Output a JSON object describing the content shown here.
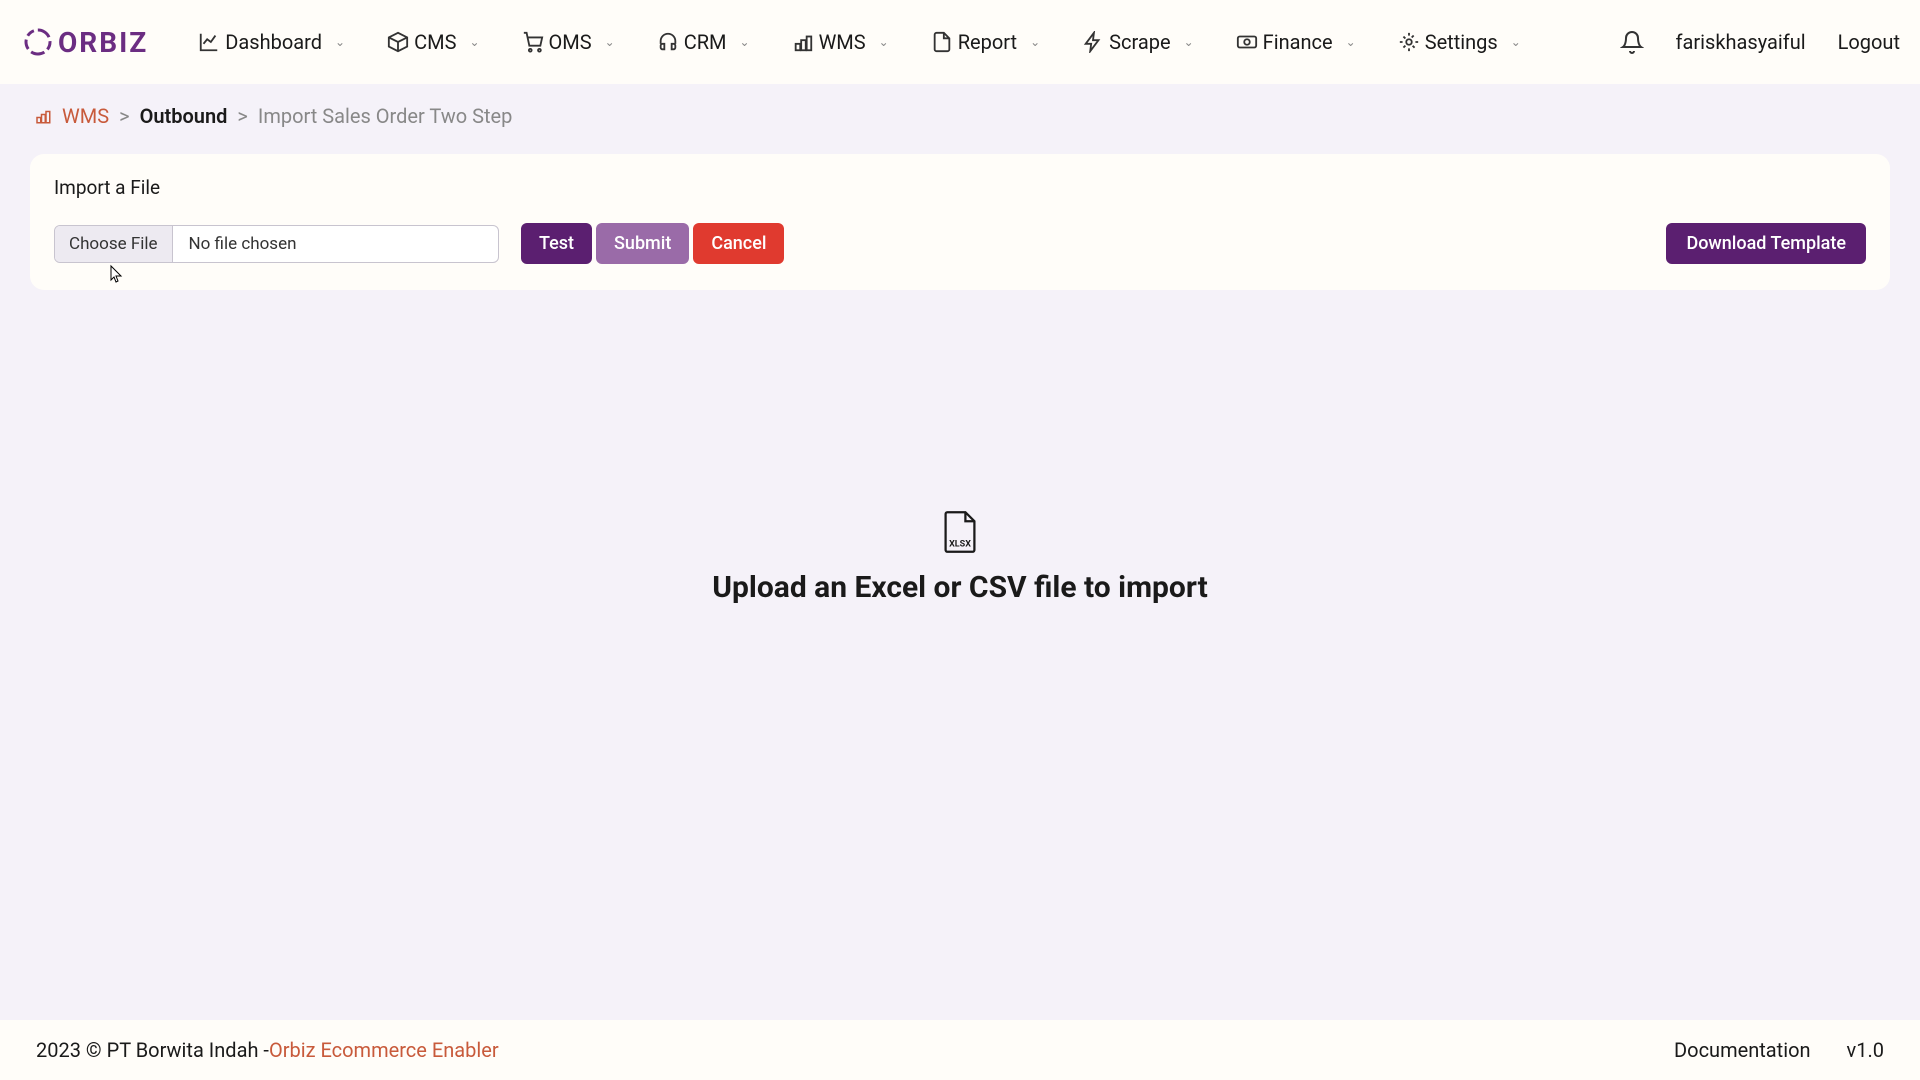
{
  "logo": {
    "text": "ORBIZ"
  },
  "nav": {
    "items": [
      {
        "label": "Dashboard",
        "icon": "chart-line"
      },
      {
        "label": "CMS",
        "icon": "box"
      },
      {
        "label": "OMS",
        "icon": "cart"
      },
      {
        "label": "CRM",
        "icon": "headset"
      },
      {
        "label": "WMS",
        "icon": "warehouse"
      },
      {
        "label": "Report",
        "icon": "document"
      },
      {
        "label": "Scrape",
        "icon": "bolt"
      },
      {
        "label": "Finance",
        "icon": "money"
      },
      {
        "label": "Settings",
        "icon": "gear"
      }
    ]
  },
  "user": {
    "name": "fariskhasyaiful",
    "logout": "Logout"
  },
  "breadcrumb": {
    "root": "WMS",
    "section": "Outbound",
    "current": "Import Sales Order Two Step"
  },
  "card": {
    "title": "Import a File",
    "choose_file": "Choose File",
    "file_status": "No file chosen",
    "test": "Test",
    "submit": "Submit",
    "cancel": "Cancel",
    "download": "Download Template"
  },
  "main": {
    "file_type": "XLSX",
    "upload_prompt": "Upload an Excel or CSV file to import"
  },
  "footer": {
    "copyright": "2023 © PT Borwita Indah - ",
    "brand": "Orbiz Ecommerce Enabler",
    "docs": "Documentation",
    "version": "v1.0"
  }
}
